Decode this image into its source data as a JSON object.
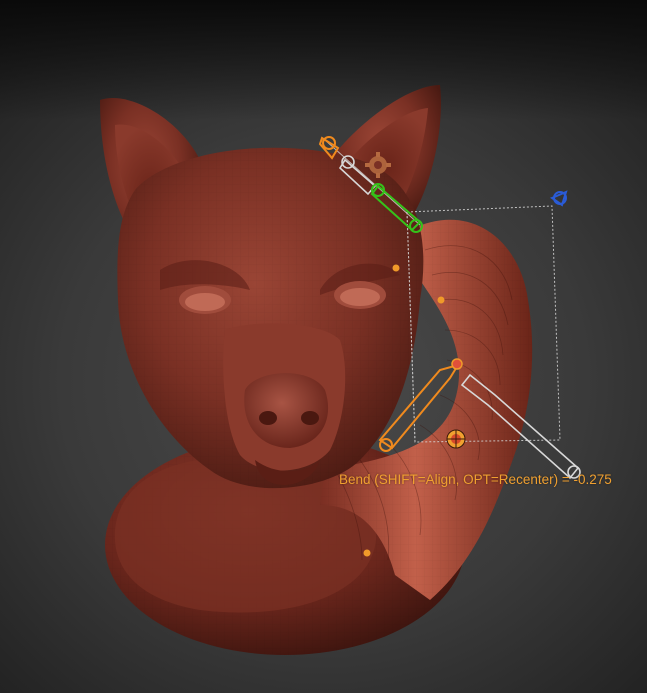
{
  "viewport": {
    "background": "#3a3a3a",
    "model_color": "#8a3a2c",
    "deformer_color": "#a84a36"
  },
  "gizmo": {
    "handle_colors": {
      "orange": "#f08a1e",
      "white": "#d8d8d8",
      "green": "#35c21a",
      "blue": "#2a5bd6",
      "dot": "#f09a2a"
    },
    "icons": [
      "gear-icon",
      "pivot-icon"
    ],
    "status_text": "Bend (SHIFT=Align, OPT=Recenter) = -0.275",
    "status_color": "#f0a030"
  }
}
